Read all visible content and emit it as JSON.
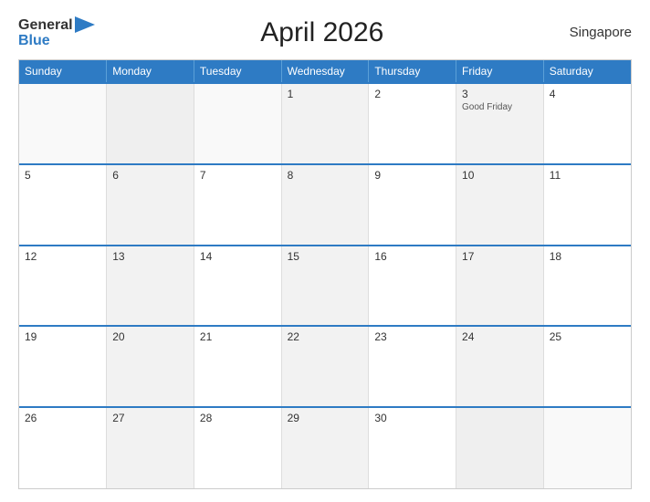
{
  "header": {
    "title": "April 2026",
    "region": "Singapore",
    "logo_general": "General",
    "logo_blue": "Blue"
  },
  "days_of_week": [
    "Sunday",
    "Monday",
    "Tuesday",
    "Wednesday",
    "Thursday",
    "Friday",
    "Saturday"
  ],
  "weeks": [
    [
      {
        "day": "",
        "empty": true
      },
      {
        "day": "",
        "empty": true
      },
      {
        "day": "",
        "empty": true
      },
      {
        "day": "1",
        "empty": false
      },
      {
        "day": "2",
        "empty": false
      },
      {
        "day": "3",
        "holiday": "Good Friday",
        "empty": false
      },
      {
        "day": "4",
        "empty": false
      }
    ],
    [
      {
        "day": "5",
        "empty": false
      },
      {
        "day": "6",
        "empty": false
      },
      {
        "day": "7",
        "empty": false
      },
      {
        "day": "8",
        "empty": false
      },
      {
        "day": "9",
        "empty": false
      },
      {
        "day": "10",
        "empty": false
      },
      {
        "day": "11",
        "empty": false
      }
    ],
    [
      {
        "day": "12",
        "empty": false
      },
      {
        "day": "13",
        "empty": false
      },
      {
        "day": "14",
        "empty": false
      },
      {
        "day": "15",
        "empty": false
      },
      {
        "day": "16",
        "empty": false
      },
      {
        "day": "17",
        "empty": false
      },
      {
        "day": "18",
        "empty": false
      }
    ],
    [
      {
        "day": "19",
        "empty": false
      },
      {
        "day": "20",
        "empty": false
      },
      {
        "day": "21",
        "empty": false
      },
      {
        "day": "22",
        "empty": false
      },
      {
        "day": "23",
        "empty": false
      },
      {
        "day": "24",
        "empty": false
      },
      {
        "day": "25",
        "empty": false
      }
    ],
    [
      {
        "day": "26",
        "empty": false
      },
      {
        "day": "27",
        "empty": false
      },
      {
        "day": "28",
        "empty": false
      },
      {
        "day": "29",
        "empty": false
      },
      {
        "day": "30",
        "empty": false
      },
      {
        "day": "",
        "empty": true
      },
      {
        "day": "",
        "empty": true
      }
    ]
  ]
}
